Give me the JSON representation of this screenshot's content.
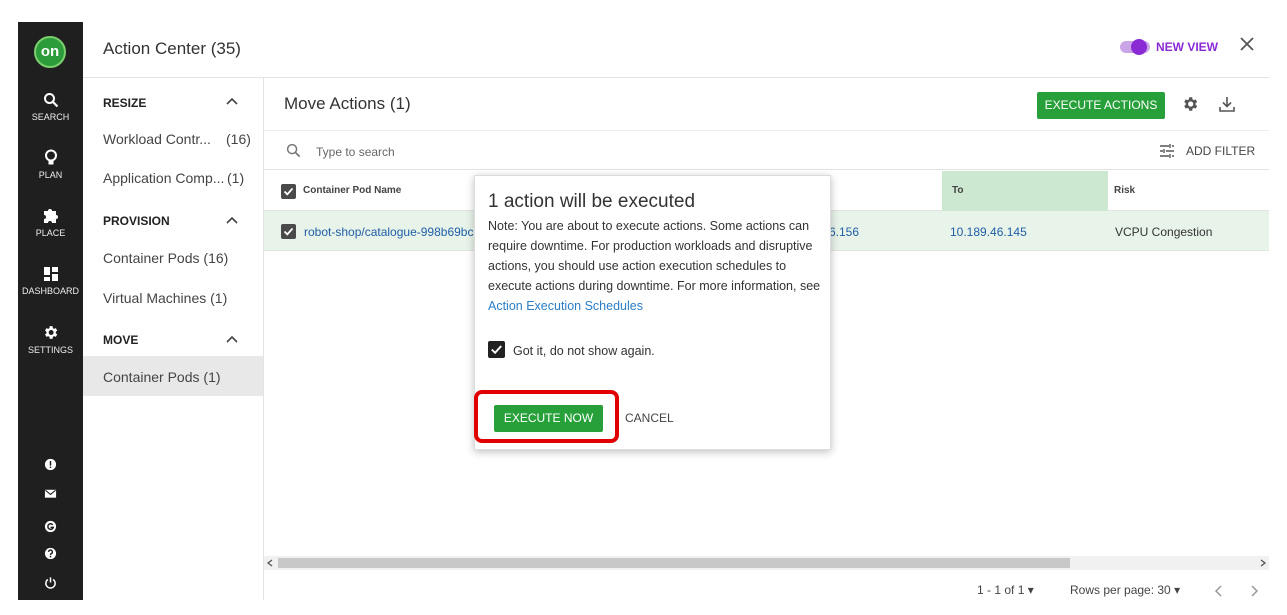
{
  "nav": {
    "logo": "on",
    "items": [
      {
        "label": "SEARCH",
        "icon": "search-icon"
      },
      {
        "label": "PLAN",
        "icon": "lightbulb-icon"
      },
      {
        "label": "PLACE",
        "icon": "puzzle-icon"
      },
      {
        "label": "DASHBOARD",
        "icon": "dashboard-icon"
      },
      {
        "label": "SETTINGS",
        "icon": "gear-icon"
      }
    ],
    "bottom_icons": [
      "alert-icon",
      "mail-icon",
      "g-icon",
      "help-icon",
      "power-icon"
    ]
  },
  "header": {
    "title": "Action Center (35)",
    "toggle_label": "NEW VIEW",
    "accent": "#8a2bd6"
  },
  "sidebar": {
    "sections": [
      {
        "title": "RESIZE",
        "items": [
          {
            "label": "Workload Contr...",
            "count": "(16)"
          },
          {
            "label": "Application Comp...",
            "count": "(1)"
          }
        ]
      },
      {
        "title": "PROVISION",
        "items": [
          {
            "label": "Container Pods",
            "count": "(16)"
          },
          {
            "label": "Virtual Machines",
            "count": "(1)"
          }
        ]
      },
      {
        "title": "MOVE",
        "items": [
          {
            "label": "Container Pods",
            "count": "(1)"
          }
        ]
      }
    ]
  },
  "main": {
    "title": "Move Actions (1)",
    "execute_label": "EXECUTE ACTIONS",
    "search_placeholder": "Type to search",
    "add_filter": "ADD FILTER",
    "columns": {
      "pod": "Container Pod Name",
      "to": "To",
      "risk": "Risk"
    },
    "row": {
      "pod": "robot-shop/catalogue-998b69bc9",
      "from_tail": "6.156",
      "to": "10.189.46.145",
      "risk": "VCPU Congestion"
    },
    "pager": "1 - 1 of 1",
    "rows_per_page": "Rows per page: 30"
  },
  "dialog": {
    "title": "1 action will be executed",
    "note": "Note: You are about to execute actions. Some actions can require downtime. For production workloads and disruptive actions, you should use action execution schedules to execute actions during downtime. For more information, see",
    "link": "Action Execution Schedules",
    "checkbox_label": "Got it, do not show again.",
    "execute_now": "EXECUTE NOW",
    "cancel": "CANCEL"
  },
  "colors": {
    "primary_green": "#27a03a",
    "highlight_red": "#e00000",
    "nav_bg": "#1f1f1f"
  }
}
